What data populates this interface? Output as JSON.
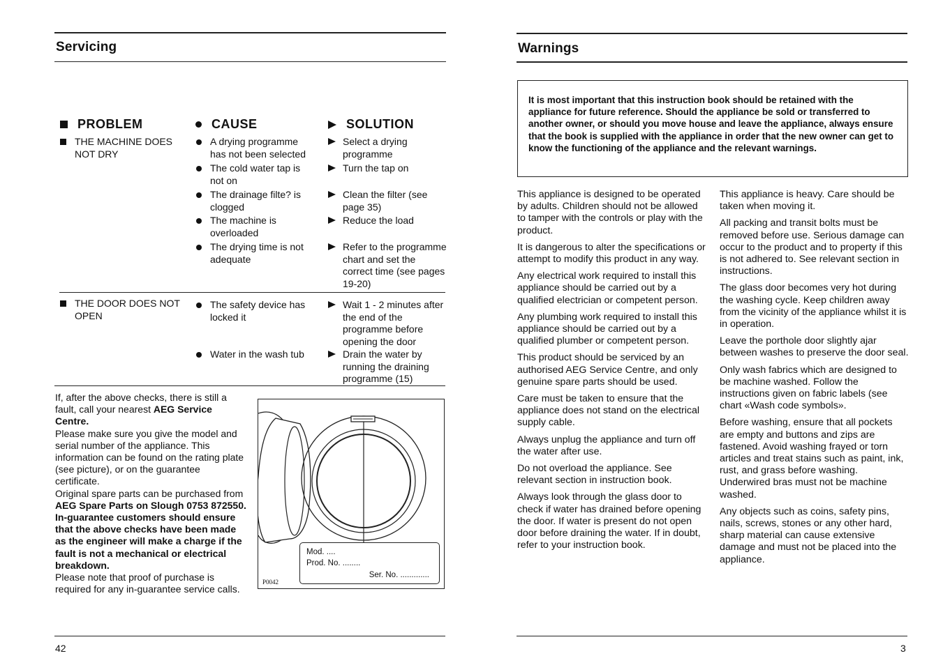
{
  "left_page": {
    "title": "Servicing",
    "table": {
      "headers": {
        "problem": "PROBLEM",
        "cause": "CAUSE",
        "solution": "SOLUTION"
      },
      "groups": [
        {
          "problem": "THE MACHINE DOES\nNOT DRY",
          "rows": [
            {
              "cause": "A drying programme\nhas not been selected",
              "solution": "Select a drying\nprogramme"
            },
            {
              "cause": "The cold water tap is\nnot on",
              "solution": "Turn the tap on"
            },
            {
              "cause": "The drainage filte? is\nclogged",
              "solution": "Clean the filter (see\npage 35)"
            },
            {
              "cause": "The machine is\noverloaded",
              "solution": "Reduce the load"
            },
            {
              "cause": "The drying time is not\nadequate",
              "solution": "Refer to the programme\nchart and set the\ncorrect time (see pages\n19-20)"
            }
          ]
        },
        {
          "problem": "THE DOOR DOES NOT\nOPEN",
          "rows": [
            {
              "cause": "The safety device has\nlocked it",
              "solution": "Wait 1 - 2 minutes after\nthe end of the\nprogramme before\nopening the door"
            },
            {
              "cause": "Water in the wash tub",
              "solution": "Drain the water by\nrunning the draining\nprogramme (15)"
            }
          ]
        }
      ]
    },
    "service_text": {
      "p1_a": "If, after the above checks, there is still a fault, call your nearest ",
      "p1_b": "AEG Service Centre.",
      "p2": "Please make sure you give the model and serial number of the appliance. This information can be found on the rating plate (see picture), or on the guarantee certificate.",
      "p3_a": "Original spare parts can be purchased from ",
      "p3_b": "AEG Spare Parts on Slough 0753 872550.",
      "p4": "In-guarantee customers should ensure that the above checks have been made as the engineer will make a charge if the fault is not a mechanical or electrical breakdown.",
      "p5": "Please note that proof of purchase is required for any in-guarantee service calls."
    },
    "figure": {
      "plate_model": "Mod. ....",
      "plate_prod": "Prod. No. ........",
      "plate_serial": "Ser. No. .............",
      "code": "P0042"
    },
    "page_number": "42"
  },
  "right_page": {
    "title": "Warnings",
    "notice": "It is most important that this instruction book should be retained with the appliance for future reference. Should the appliance be sold or transferred to another owner, or should you move house and leave the appliance, always ensure that the book is supplied with the appliance in order that the new owner can get to know the functioning of the appliance and the relevant warnings.",
    "col1": [
      "This appliance is designed to be operated by adults. Children should not be allowed to tamper with the controls or play with the product.",
      "It is dangerous to alter the specifications or attempt to modify this product in any way.",
      "Any electrical work required to install this appliance should be carried out by a qualified electrician or competent person.",
      "Any plumbing work required to install this appliance should be carried out by a qualified plumber or competent person.",
      "This product should be serviced by an authorised AEG Service Centre, and only genuine spare parts should be used.",
      "Care must be taken to ensure that the appliance does not stand on the electrical supply cable.",
      "Always unplug the appliance and turn off the water after use.",
      "Do not overload the appliance. See relevant section in instruction book.",
      "Always look through the glass door to check if water has drained before opening the door. If water is present do not open door before draining the water. If in doubt, refer to your instruction book."
    ],
    "col2": [
      "This appliance is heavy. Care should be taken when moving it.",
      "All packing and transit bolts must be removed before use. Serious damage can occur to the product and to property if this is not adhered to. See relevant section in instructions.",
      "The glass door becomes very hot during the washing cycle. Keep children away from the vicinity of the appliance whilst it is in operation.",
      "Leave the porthole door slightly ajar between washes to preserve the door seal.",
      "Only wash fabrics which are designed to be machine washed. Follow the instructions given on fabric labels (see chart «Wash code symbols».",
      "Before washing, ensure that all pockets are empty and buttons and zips are fastened. Avoid washing frayed or torn articles and treat stains such as paint, ink, rust, and grass before washing. Underwired bras must not be machine washed.",
      "Any objects such as coins, safety pins, nails, screws, stones or any other hard, sharp material can cause extensive damage and must not be placed into the appliance."
    ],
    "page_number": "3"
  }
}
